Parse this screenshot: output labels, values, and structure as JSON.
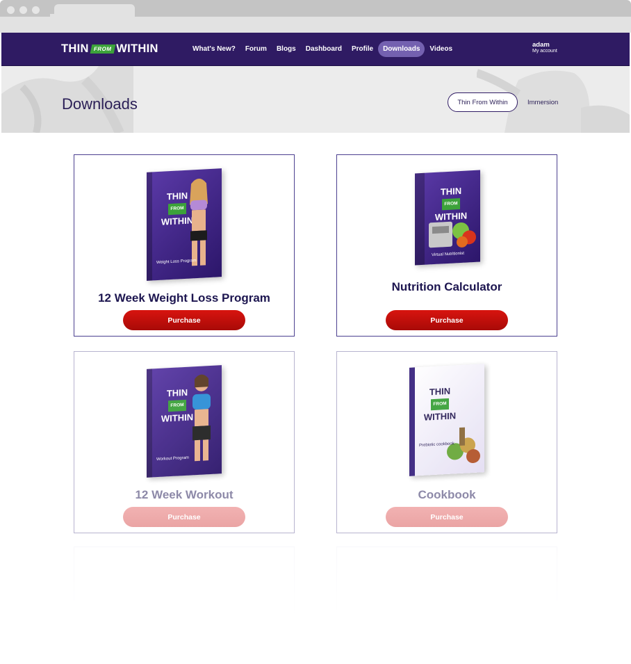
{
  "nav": {
    "logo_left": "THIN",
    "logo_mid": "FROM",
    "logo_right": "WITHIN",
    "items": [
      {
        "label": "What's New?"
      },
      {
        "label": "Forum"
      },
      {
        "label": "Blogs"
      },
      {
        "label": "Dashboard"
      },
      {
        "label": "Profile"
      },
      {
        "label": "Downloads",
        "active": true
      },
      {
        "label": "Videos"
      }
    ],
    "user_name": "adam",
    "user_link": "My account"
  },
  "hero": {
    "title": "Downloads",
    "pill": "Thin From Within",
    "link": "Immersion"
  },
  "products": [
    {
      "title": "12 Week Weight Loss Program",
      "button": "Purchase",
      "cover_sub": "Weight Loss Program"
    },
    {
      "title": "Nutrition Calculator",
      "button": "Purchase",
      "cover_sub": "Virtual Nutritionist"
    },
    {
      "title": "12 Week Workout",
      "button": "Purchase",
      "cover_sub": "Workout Program"
    },
    {
      "title": "Cookbook",
      "button": "Purchase",
      "cover_sub": "Prebiotic cookbook"
    }
  ],
  "cover_brand": {
    "top": "THIN",
    "mid": "FROM",
    "bottom": "WITHIN"
  },
  "colors": {
    "nav_bg": "#2f1b63",
    "accent_green": "#3ca23a",
    "purchase_red": "#c40f0b",
    "active_pill": "#7461b0"
  }
}
